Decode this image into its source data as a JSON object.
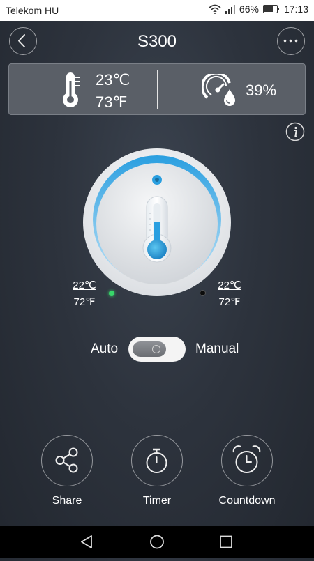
{
  "status_bar": {
    "carrier": "Telekom HU",
    "battery": "66%",
    "time": "17:13"
  },
  "header": {
    "title": "S300",
    "back_icon": "chevron-left-icon",
    "more_icon": "more-horizontal-icon"
  },
  "info_panel": {
    "temperature_c": "23℃",
    "temperature_f": "73℉",
    "humidity": "39%"
  },
  "dial": {
    "left_setpoint_c": "22℃",
    "left_setpoint_f": "72℉",
    "right_setpoint_c": "22℃",
    "right_setpoint_f": "72℉",
    "accent_color": "#2a9fe0"
  },
  "mode": {
    "auto_label": "Auto",
    "manual_label": "Manual"
  },
  "actions": {
    "share_label": "Share",
    "timer_label": "Timer",
    "countdown_label": "Countdown"
  }
}
